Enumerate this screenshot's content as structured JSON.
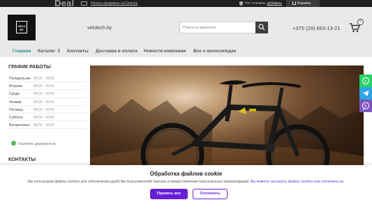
{
  "topbar": {
    "brand": "Deal",
    "deal_link": "Начать продавать на Deal.by",
    "reviews_text": "Нет отзывов, ",
    "reviews_link": "добавить",
    "cart_label": "Корзина"
  },
  "header": {
    "logo_line1": "VELO",
    "logo_line2": "BY",
    "site_name": "velotech.by",
    "search_placeholder": "Поиск по магазину",
    "phone": "+375 (29) 663-13-21",
    "cart_count": "0"
  },
  "nav": {
    "items": [
      {
        "label": "Главная"
      },
      {
        "label": "Каталог"
      },
      {
        "label": "Контакты"
      },
      {
        "label": "Доставка и оплата"
      },
      {
        "label": "Новости компании"
      },
      {
        "label": "Все о велосипедах"
      }
    ]
  },
  "sidebar": {
    "schedule_title": "ГРАФИК РАБОТЫ",
    "schedule": [
      {
        "day": "Понедельник",
        "hours": "08:00 - 23:00"
      },
      {
        "day": "Вторник",
        "hours": "08:00 - 23:00"
      },
      {
        "day": "Среда",
        "hours": "08:00 - 23:00"
      },
      {
        "day": "Четверг",
        "hours": "08:00 - 23:00"
      },
      {
        "day": "Пятница",
        "hours": "08:00 - 23:00"
      },
      {
        "day": "Суббота",
        "hours": "08:00 - 23:00"
      },
      {
        "day": "Воскресенье",
        "hours": "08:00 - 23:00"
      }
    ],
    "docs_label": "Наличие документов",
    "contacts_title": "КОНТАКТЫ"
  },
  "floats": [
    {
      "icon": "whatsapp-icon",
      "color": "#25d366"
    },
    {
      "icon": "telegram-icon",
      "color": "#2ca5e0"
    },
    {
      "icon": "viber-icon",
      "color": "#7d57c1"
    }
  ],
  "cookie": {
    "title": "Обработка файлов cookie",
    "text": "Мы используем файлы cookies для обеспечения удобства пользователей портала и предоставления персональных рекомендаций.",
    "link": "Вы можете настроить файлы cookies или отключить их.",
    "accept_label": "Принять все",
    "decline_label": "Отклонить"
  },
  "colors": {
    "accent": "#2b8f8f",
    "button": "#6a1fd6",
    "docs_dot": "#5cb85c"
  }
}
